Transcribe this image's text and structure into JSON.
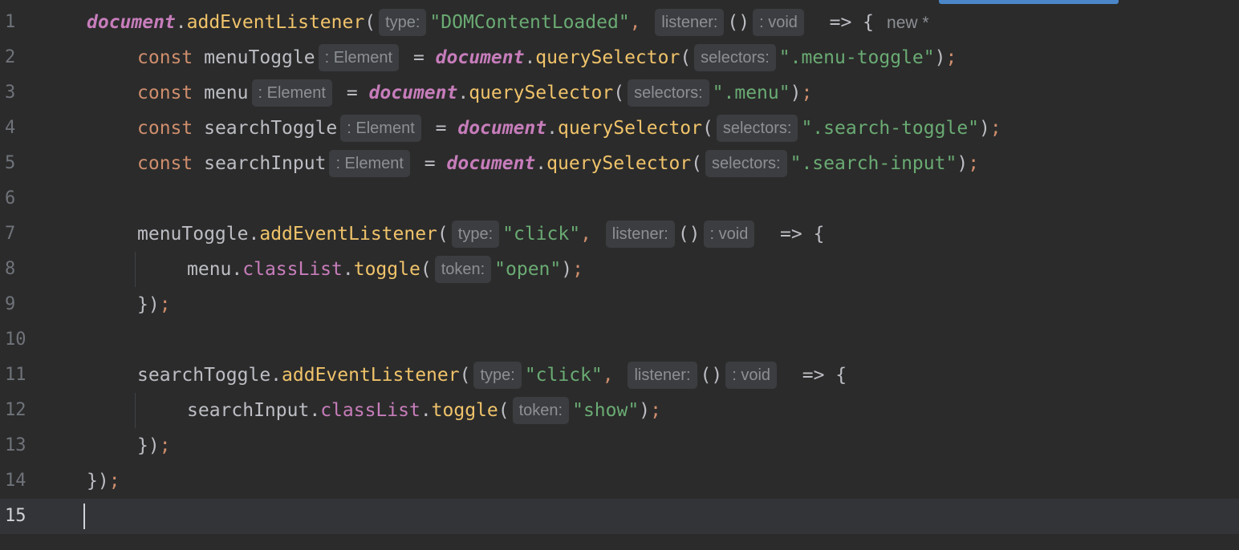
{
  "editor": {
    "line_numbers": [
      "1",
      "2",
      "3",
      "4",
      "5",
      "6",
      "7",
      "8",
      "9",
      "10",
      "11",
      "12",
      "13",
      "14",
      "15"
    ],
    "current_line": "15",
    "hints": {
      "type": "type:",
      "listener": "listener:",
      "void": ": void",
      "element": ": Element",
      "selectors": "selectors:",
      "token": "token:"
    },
    "ghost_text": "new *",
    "code": {
      "document": "document",
      "addEventListener": "addEventListener",
      "querySelector": "querySelector",
      "const": "const",
      "dom_loaded": "\"DOMContentLoaded\"",
      "menuToggle": "menuToggle",
      "menu": "menu",
      "searchToggle": "searchToggle",
      "searchInput": "searchInput",
      "sel_menu_toggle": "\".menu-toggle\"",
      "sel_menu": "\".menu\"",
      "sel_search_toggle": "\".search-toggle\"",
      "sel_search_input": "\".search-input\"",
      "click": "\"click\"",
      "classList": "classList",
      "toggle": "toggle",
      "open": "\"open\"",
      "show": "\"show\""
    }
  }
}
